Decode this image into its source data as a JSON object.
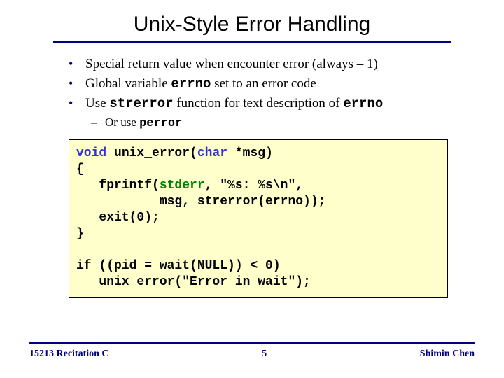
{
  "title": "Unix-Style Error Handling",
  "bullets": {
    "b1_pre": "Special return value when encounter error (always – 1)",
    "b2_pre": "Global variable ",
    "b2_code": "errno",
    "b2_post": " set to an error code",
    "b3_pre": "Use  ",
    "b3_code1": "strerror",
    "b3_mid": " function for text description of ",
    "b3_code2": "errno",
    "sub_pre": "Or use ",
    "sub_code": "perror"
  },
  "code": {
    "l1a": "void",
    "l1b": " unix_error(",
    "l1c": "char",
    "l1d": " *msg)",
    "l2": "{",
    "l3a": "   fprintf(",
    "l3b": "stderr",
    "l3c": ", \"%s: %s\\n\",",
    "l4": "           msg, strerror(errno));",
    "l5": "   exit(0);",
    "l6": "}",
    "blank": "",
    "l7": "if ((pid = wait(NULL)) < 0)",
    "l8": "   unix_error(\"Error in wait\");"
  },
  "footer": {
    "left": "15213 Recitation C",
    "center": "5",
    "right": "Shimin Chen"
  }
}
